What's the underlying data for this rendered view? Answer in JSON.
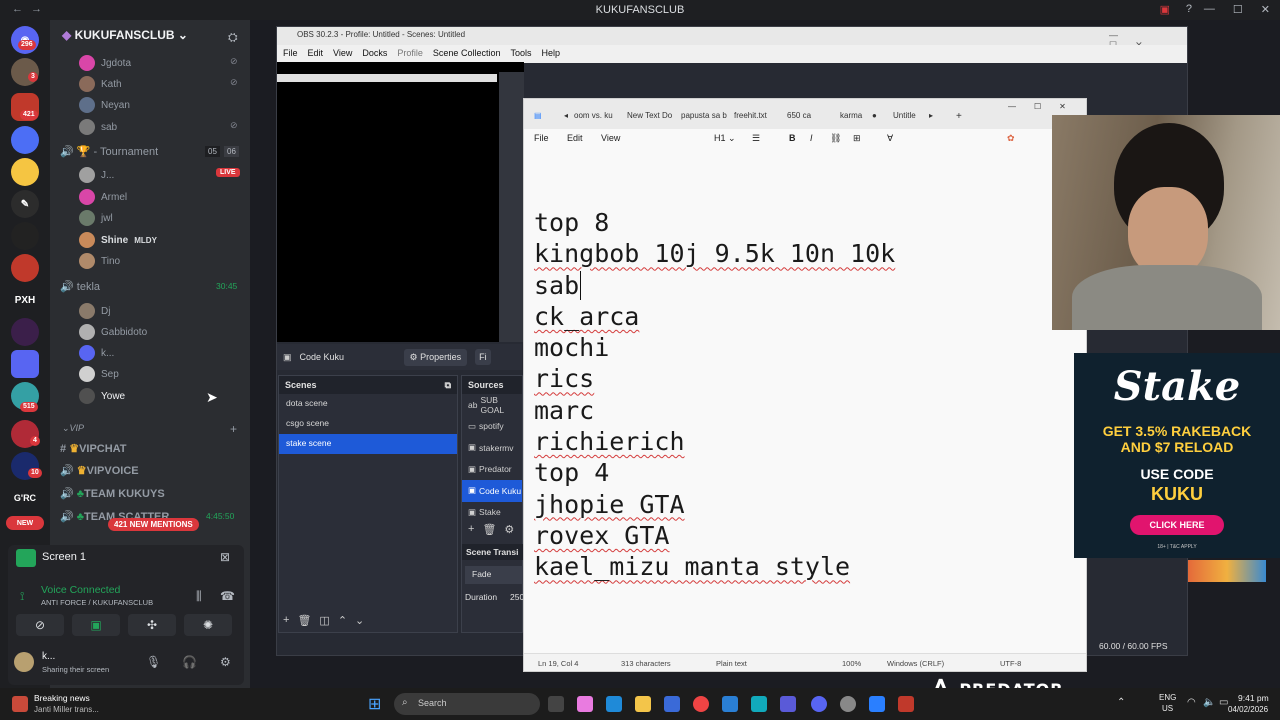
{
  "discord": {
    "window_title": "KUKUFANSCLUB",
    "server_name": "KUKUFANSCLUB",
    "servers": [
      {
        "badge": "296"
      },
      {
        "badge": "3"
      },
      {
        "badge": "421"
      },
      {
        "badge": ""
      },
      {
        "badge": ""
      },
      {
        "badge": ""
      },
      {
        "badge": ""
      },
      {
        "badge": ""
      },
      {
        "label": "PXH"
      },
      {
        "badge": ""
      },
      {
        "badge": ""
      },
      {
        "badge": "515"
      },
      {
        "badge": "4"
      },
      {
        "badge": "10"
      },
      {
        "label": "G'RC"
      },
      {
        "label": "NEW"
      }
    ],
    "voice_users_top": [
      "Jgdota",
      "Kath",
      "Neyan",
      "sab"
    ],
    "tournament_channel": "- Tournament",
    "tournament_counts": [
      "05",
      "06"
    ],
    "live_badge": "LIVE",
    "tournament_users": [
      "J...",
      "Armel",
      "jwl",
      "Shine",
      "Tino"
    ],
    "shine_tag": "MLDY",
    "tekla_channel": "tekla",
    "tekla_time": "30:45",
    "tekla_users": [
      "Dj",
      "Gabbidoto",
      "k...",
      "Sep",
      "Yowe"
    ],
    "category": "VIP",
    "text_channels": [
      "VIPCHAT",
      "VIPVOICE",
      "TEAM KUKUYS",
      "TEAM SCATTER"
    ],
    "team_scatter_time": "4:45:50",
    "mentions_badge": "421 NEW MENTIONS",
    "screen_share_title": "Screen 1",
    "voice_status": "Voice Connected",
    "voice_location": "ANTI FORCE / KUKUFANSCLUB",
    "user_name": "k...",
    "user_status": "Sharing their screen"
  },
  "obs": {
    "title": "OBS 30.2.3 - Profile: Untitled - Scenes: Untitled",
    "menu": [
      "File",
      "Edit",
      "View",
      "Docks",
      "Profile",
      "Scene Collection",
      "Tools",
      "Help"
    ],
    "selected_source_label": "Code Kuku",
    "properties_label": "Properties",
    "filters_label": "Fi",
    "scenes_header": "Scenes",
    "scenes": [
      "dota scene",
      "csgo scene",
      "stake scene"
    ],
    "selected_scene": "stake scene",
    "sources_header": "Sources",
    "sources": [
      "SUB GOAL",
      "spotify",
      "stakermv",
      "Predator",
      "Code Kuku",
      "Stake"
    ],
    "selected_source": "Code Kuku",
    "transitions_header": "Scene Transi",
    "transition_value": "Fade",
    "duration_label": "Duration",
    "duration_value": "250",
    "fps": "60.00 / 60.00 FPS"
  },
  "notepad": {
    "tabs": [
      "oom vs. ku",
      "New Text Do",
      "papusta sa b",
      "freehit.txt",
      "650 ca",
      "karma",
      "Untitle"
    ],
    "menu": [
      "File",
      "Edit",
      "View"
    ],
    "heading_label": "H1",
    "lines": [
      "top 8",
      "",
      "kingbob 10j 9.5k 10n 10k",
      "sab",
      "ck_arca",
      "mochi",
      "rics",
      "marc",
      "richierich",
      "",
      "top 4",
      "jhopie GTA",
      "rovex GTA",
      "kael_mizu manta style"
    ],
    "status": {
      "position": "Ln 19, Col 4",
      "characters": "313 characters",
      "format": "Plain text",
      "zoom": "100%",
      "line_endings": "Windows (CRLF)",
      "encoding": "UTF-8"
    }
  },
  "ad": {
    "logo": "Stake",
    "line1": "GET 3.5% RAKEBACK",
    "line2": "AND $7 RELOAD",
    "line3": "USE CODE",
    "code": "KUKU",
    "button": "CLICK HERE",
    "fine": "18+ | T&C APPLY"
  },
  "overlay_brand": "PREDATOR",
  "taskbar": {
    "news_title": "Breaking news",
    "news_sub": "Janti Miller trans...",
    "search_placeholder": "Search",
    "lang": "ENG",
    "region": "US",
    "time": "9:41 pm",
    "date": "04/02/2026"
  },
  "colors": {
    "accent": "#1e5ad8",
    "discord_green": "#23a55a",
    "stake_pink": "#e1146e",
    "stake_gold": "#ffcf3e"
  }
}
